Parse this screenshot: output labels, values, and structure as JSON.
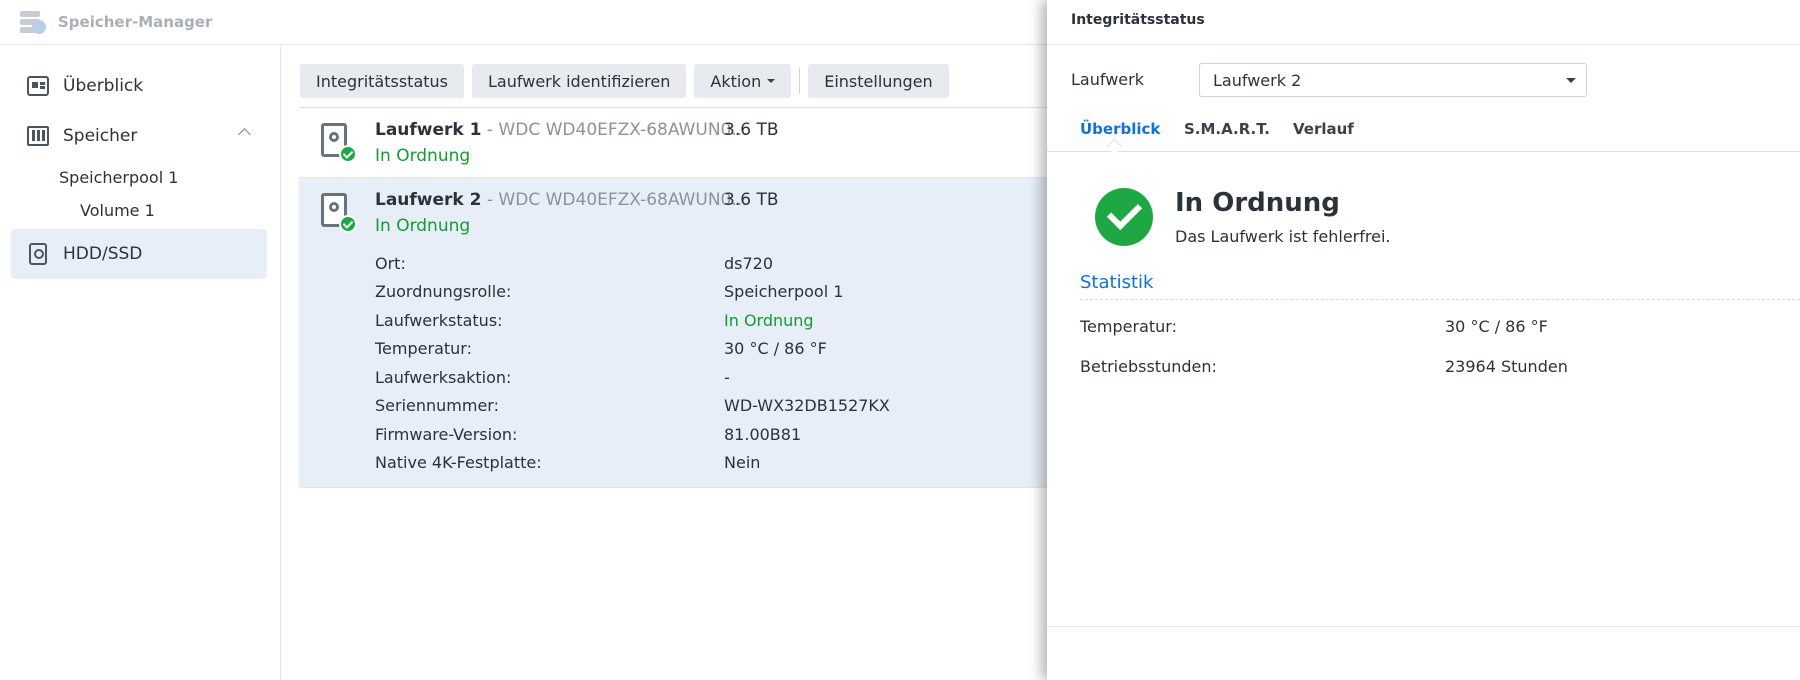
{
  "app": {
    "title": "Speicher-Manager"
  },
  "sidebar": {
    "items": [
      {
        "label": "Überblick",
        "icon": "overview-icon"
      },
      {
        "label": "Speicher",
        "icon": "storage-icon"
      },
      {
        "label": "Speicherpool 1"
      },
      {
        "label": "Volume 1"
      },
      {
        "label": "HDD/SSD",
        "icon": "hdd-icon",
        "active": true
      }
    ]
  },
  "toolbar": {
    "integrity": "Integritätsstatus",
    "identify": "Laufwerk identifizieren",
    "action": "Aktion",
    "settings": "Einstellungen"
  },
  "drives": [
    {
      "name": "Laufwerk 1",
      "model": " - WDC WD40EFZX-68AWUN0...",
      "size": "3.6 TB",
      "status": "In Ordnung"
    },
    {
      "name": "Laufwerk 2",
      "model": " - WDC WD40EFZX-68AWUN0...",
      "size": "3.6 TB",
      "status": "In Ordnung"
    }
  ],
  "details": [
    {
      "key": "Ort:",
      "value": "ds720"
    },
    {
      "key": "Zuordnungsrolle:",
      "value": "Speicherpool 1"
    },
    {
      "key": "Laufwerkstatus:",
      "value": "In Ordnung"
    },
    {
      "key": "Temperatur:",
      "value": "30 °C / 86 °F"
    },
    {
      "key": "Laufwerksaktion:",
      "value": "-"
    },
    {
      "key": "Seriennummer:",
      "value": "WD-WX32DB1527KX"
    },
    {
      "key": "Firmware-Version:",
      "value": "81.00B81"
    },
    {
      "key": "Native 4K-Festplatte:",
      "value": "Nein"
    }
  ],
  "panel": {
    "title": "Integritätsstatus",
    "drive_label": "Laufwerk",
    "drive_selected": "Laufwerk 2",
    "tabs": [
      "Überblick",
      "S.M.A.R.T.",
      "Verlauf"
    ],
    "status_title": "In Ordnung",
    "status_text": "Das Laufwerk ist fehlerfrei.",
    "section_title": "Statistik",
    "stats": [
      {
        "key": "Temperatur:",
        "value": "30 °C / 86 °F"
      },
      {
        "key": "Betriebsstunden:",
        "value": "23964 Stunden"
      }
    ]
  },
  "colors": {
    "accent": "#0f73d4",
    "ok": "#129d2e",
    "selected_bg": "#e7eef8"
  }
}
